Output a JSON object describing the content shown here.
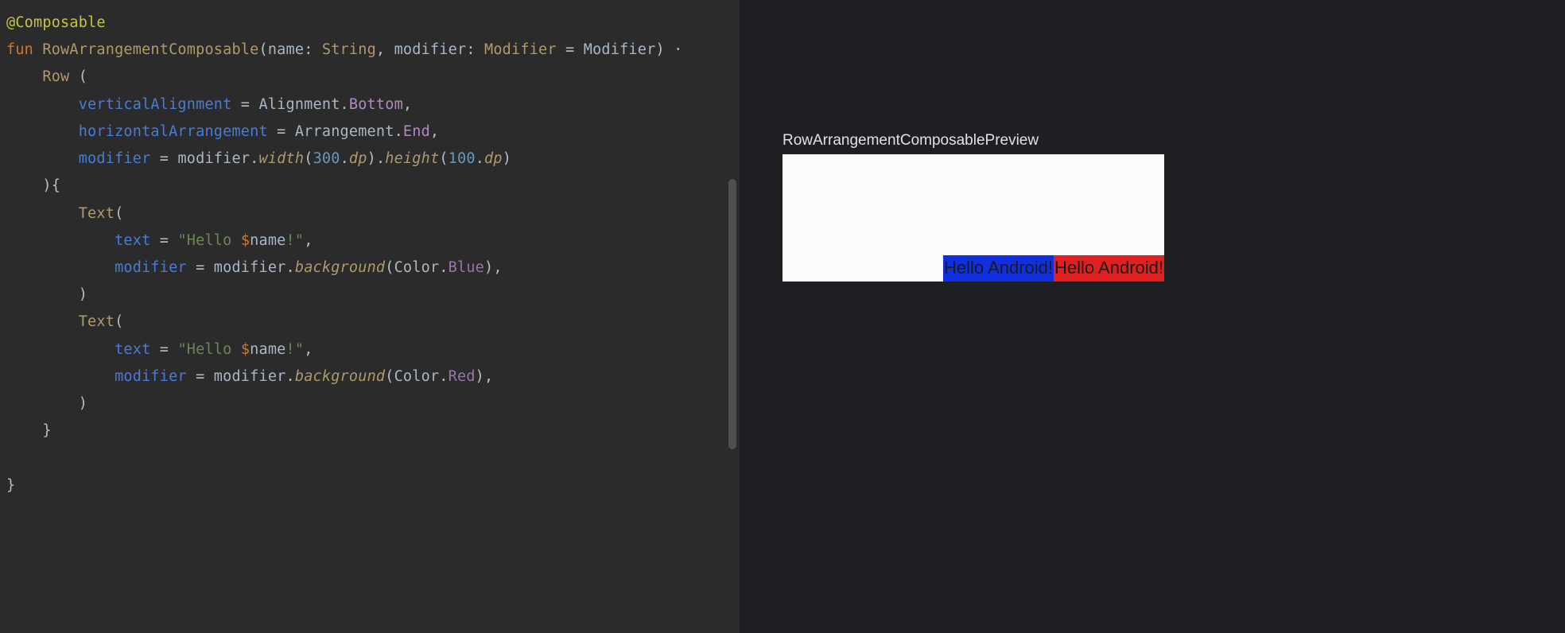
{
  "code": {
    "annotation": "@Composable",
    "funKw": "fun",
    "funcName": "RowArrangementComposable",
    "paramName1": "name",
    "paramType1": "String",
    "paramName2": "modifier",
    "paramType2": "Modifier",
    "paramDefault2": "Modifier",
    "rowCall": "Row",
    "vAlignKey": "verticalAlignment",
    "vAlignObj": "Alignment",
    "vAlignProp": "Bottom",
    "hArrKey": "horizontalArrangement",
    "hArrObj": "Arrangement",
    "hArrProp": "End",
    "modKey": "modifier",
    "modRef": "modifier",
    "widthCall": "width",
    "widthVal": "300",
    "heightCall": "height",
    "heightVal": "100",
    "dpExt": "dp",
    "textCall": "Text",
    "textKey": "text",
    "strPrefix": "\"Hello ",
    "strDollar": "$",
    "strVar": "name",
    "strSuffix": "!\"",
    "bgCall": "background",
    "colorObj": "Color",
    "colorBlue": "Blue",
    "colorRed": "Red"
  },
  "preview": {
    "title": "RowArrangementComposablePreview",
    "text1": "Hello Android!",
    "text2": "Hello Android!"
  }
}
